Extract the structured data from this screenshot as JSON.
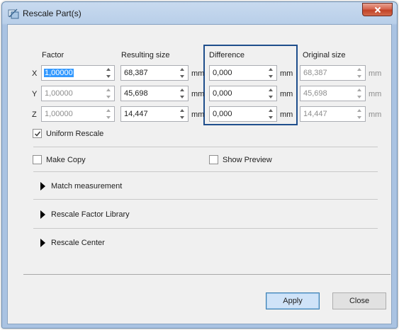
{
  "window": {
    "title": "Rescale Part(s)",
    "close_glyph": "x"
  },
  "columns": {
    "factor": "Factor",
    "resulting_size": "Resulting size",
    "difference": "Difference",
    "original_size": "Original size"
  },
  "unit": "mm",
  "rows": [
    {
      "axis": "X",
      "factor": "1,00000",
      "resulting": "68,387",
      "difference": "0,000",
      "original": "68,387"
    },
    {
      "axis": "Y",
      "factor": "1,00000",
      "resulting": "45,698",
      "difference": "0,000",
      "original": "45,698"
    },
    {
      "axis": "Z",
      "factor": "1,00000",
      "resulting": "14,447",
      "difference": "0,000",
      "original": "14,447"
    }
  ],
  "options": {
    "uniform_rescale": {
      "label": "Uniform Rescale",
      "checked": true
    },
    "make_copy": {
      "label": "Make Copy",
      "checked": false
    },
    "show_preview": {
      "label": "Show Preview",
      "checked": false
    }
  },
  "sections": {
    "match_measurement": "Match measurement",
    "rescale_factor_library": "Rescale Factor Library",
    "rescale_center": "Rescale Center"
  },
  "buttons": {
    "apply": "Apply",
    "close": "Close"
  },
  "colors": {
    "highlight_box": "#1f4e8c",
    "selection": "#3399ff",
    "close_button": "#c24327"
  }
}
